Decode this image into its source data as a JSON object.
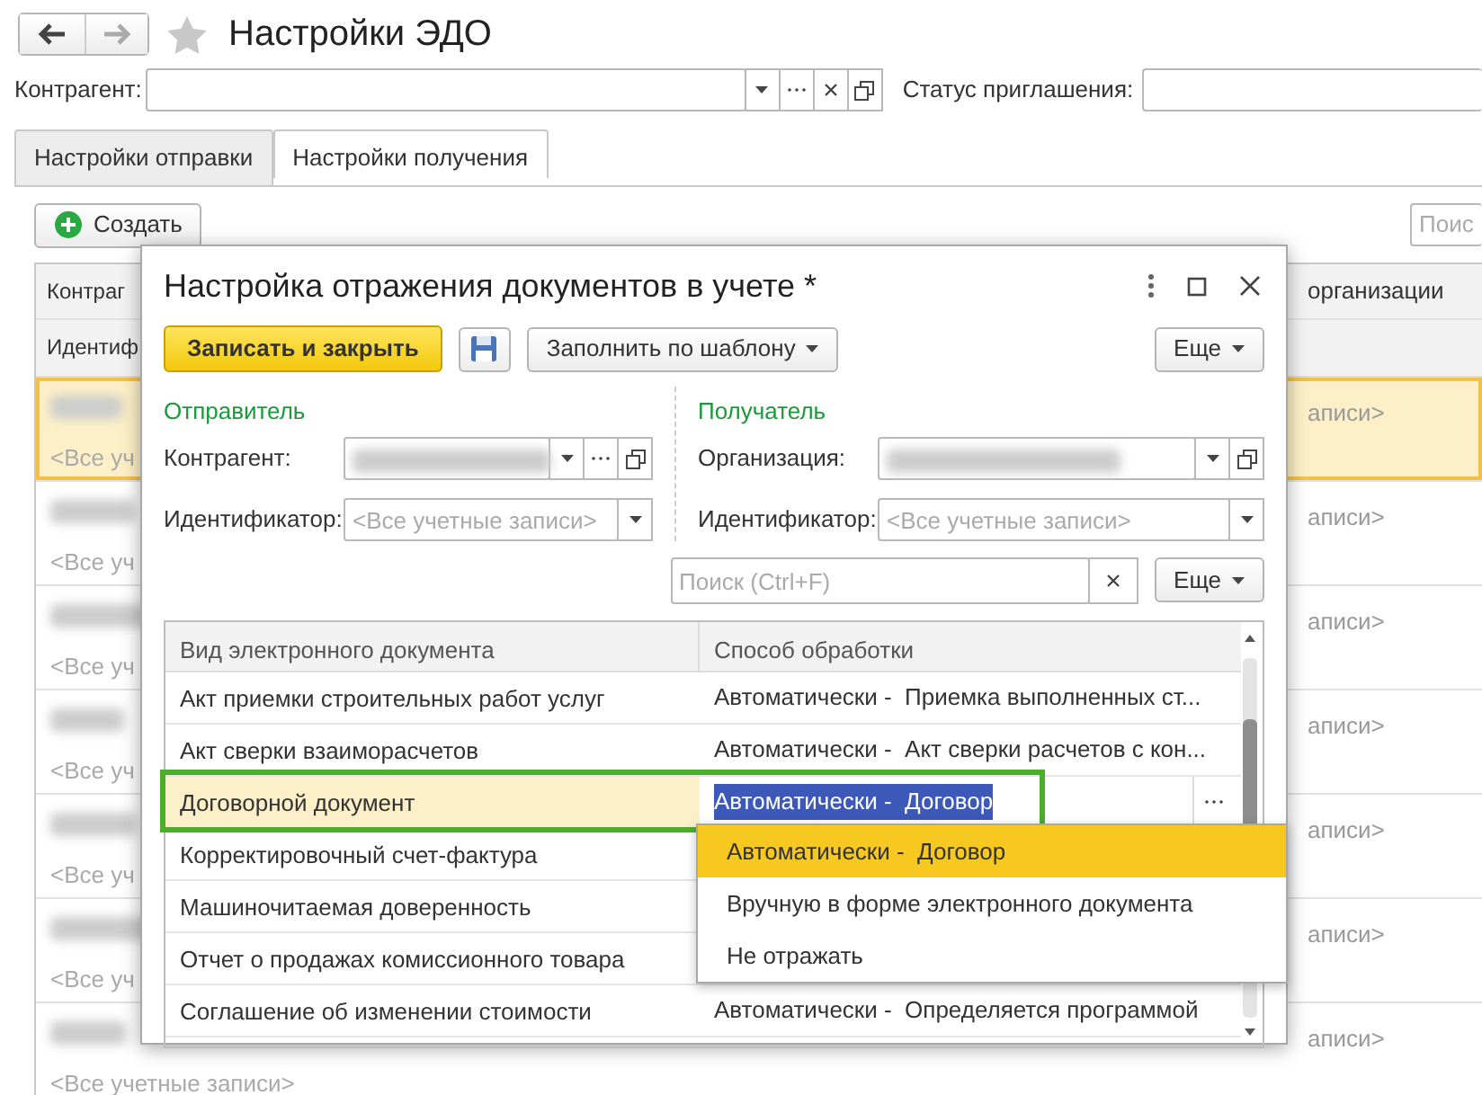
{
  "nav": {
    "title": "Настройки ЭДО"
  },
  "filters": [
    {
      "label": "Контрагент:"
    },
    {
      "label": "Статус приглашения:"
    }
  ],
  "tabs": [
    {
      "label": "Настройки отправки",
      "selected": false
    },
    {
      "label": "Настройки получения",
      "selected": true
    }
  ],
  "toolbar": {
    "create": "Создать",
    "search_placeholder": "Поис"
  },
  "list": {
    "header_left": [
      "Контраг",
      "Идентиф"
    ],
    "header_right": "организации",
    "rows": [
      {
        "selected": true,
        "left": "<Все уч",
        "right": "аписи>"
      },
      {
        "selected": false,
        "left": "<Все уч",
        "right": "аписи>"
      },
      {
        "selected": false,
        "left": "<Все уч",
        "right": "аписи>"
      },
      {
        "selected": false,
        "left": "<Все уч",
        "right": "аписи>"
      },
      {
        "selected": false,
        "left": "<Все уч",
        "right": "аписи>"
      },
      {
        "selected": false,
        "left": "<Все уч",
        "right": "аписи>"
      },
      {
        "selected": false,
        "left": "<Все учетные записи>",
        "right": "аписи>"
      }
    ]
  },
  "dialog": {
    "title": "Настройка отражения документов в учете *",
    "save_close": "Записать и закрыть",
    "fill_template": "Заполнить по шаблону",
    "more": "Еще",
    "sender": {
      "heading": "Отправитель",
      "field_label": "Контрагент:",
      "id_label": "Идентификатор:",
      "id_placeholder": "<Все учетные записи>"
    },
    "receiver": {
      "heading": "Получатель",
      "field_label": "Организация:",
      "id_label": "Идентификатор:",
      "id_placeholder": "<Все учетные записи>"
    },
    "search": {
      "placeholder": "Поиск (Ctrl+F)",
      "more": "Еще"
    },
    "table": {
      "columns": [
        "Вид электронного документа",
        "Способ обработки"
      ],
      "rows": [
        {
          "doc": "Акт приемки строительных работ услуг",
          "method": "Автоматически -  Приемка выполненных ст...",
          "selected": false
        },
        {
          "doc": "Акт сверки взаиморасчетов",
          "method": "Автоматически -  Акт сверки расчетов с кон...",
          "selected": false
        },
        {
          "doc": "Договорной документ",
          "method": "Автоматически -  Договор",
          "selected": true
        },
        {
          "doc": "Корректировочный счет-фактура",
          "selected": false
        },
        {
          "doc": "Машиночитаемая доверенность",
          "selected": false
        },
        {
          "doc": "Отчет о продажах комиссионного товара",
          "selected": false
        },
        {
          "doc": "Соглашение об изменении стоимости",
          "method": "Автоматически -  Определяется программой",
          "selected": false
        }
      ]
    },
    "dropdown": [
      {
        "label": "Автоматически -  Договор",
        "selected": true
      },
      {
        "label": "Вручную в форме электронного документа",
        "selected": false
      },
      {
        "label": "Не отражать",
        "selected": false
      }
    ]
  }
}
